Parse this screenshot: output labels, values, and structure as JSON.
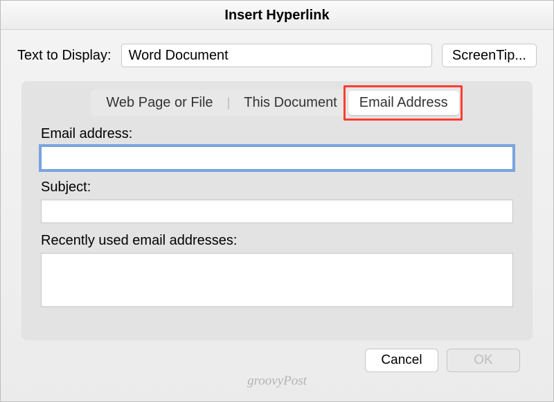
{
  "dialog": {
    "title": "Insert Hyperlink"
  },
  "display": {
    "label": "Text to Display:",
    "value": "Word Document",
    "screentip_label": "ScreenTip..."
  },
  "tabs": {
    "items": [
      {
        "label": "Web Page or File",
        "active": false
      },
      {
        "label": "This Document",
        "active": false
      },
      {
        "label": "Email Address",
        "active": true
      }
    ]
  },
  "fields": {
    "email_label": "Email address:",
    "email_value": "",
    "subject_label": "Subject:",
    "subject_value": "",
    "recent_label": "Recently used email addresses:"
  },
  "footer": {
    "cancel_label": "Cancel",
    "ok_label": "OK"
  },
  "watermark": "groovyPost"
}
